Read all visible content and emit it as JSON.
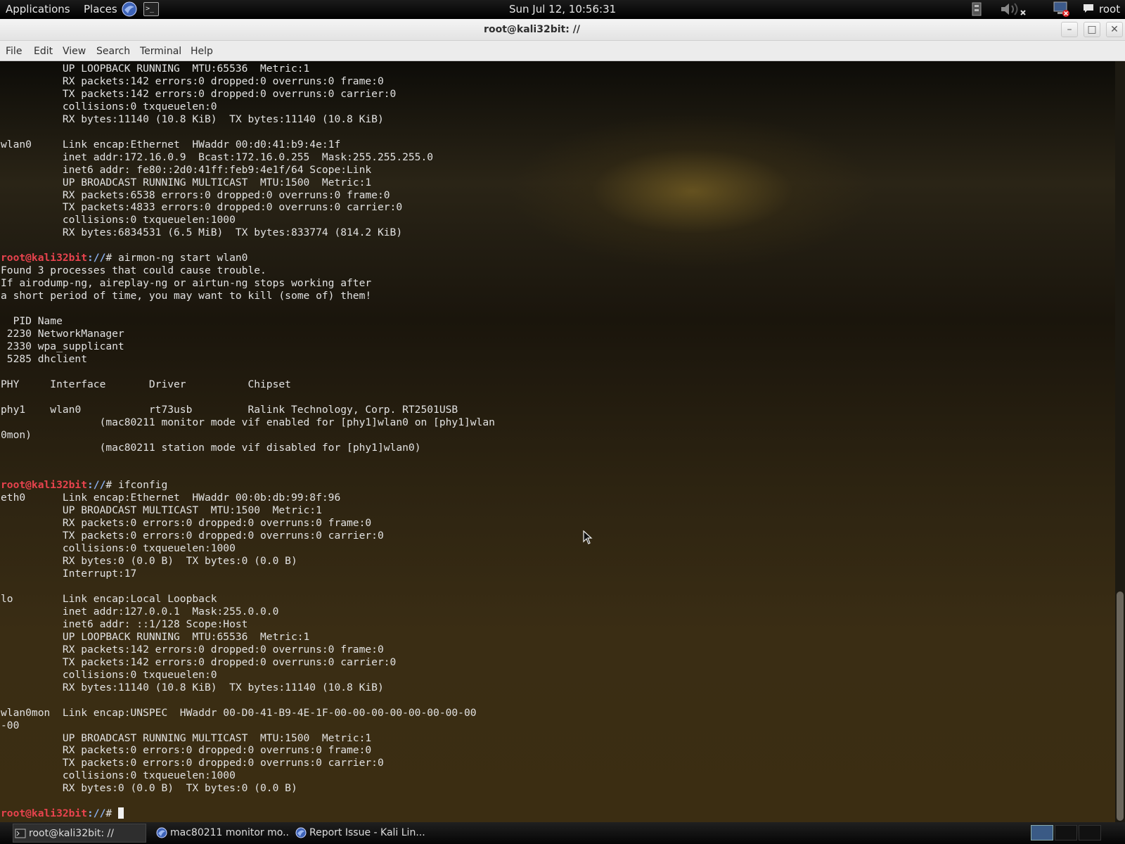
{
  "top_panel": {
    "applications": "Applications",
    "places": "Places",
    "clock": "Sun Jul 12, 10:56:31",
    "user": "root"
  },
  "window": {
    "title": "root@kali32bit: //",
    "menu": [
      "File",
      "Edit",
      "View",
      "Search",
      "Terminal",
      "Help"
    ]
  },
  "terminal": {
    "prompt_user": "root@kali32bit",
    "prompt_path": "://",
    "lines_before_1": [
      "          UP LOOPBACK RUNNING  MTU:65536  Metric:1",
      "          RX packets:142 errors:0 dropped:0 overruns:0 frame:0",
      "          TX packets:142 errors:0 dropped:0 overruns:0 carrier:0",
      "          collisions:0 txqueuelen:0",
      "          RX bytes:11140 (10.8 KiB)  TX bytes:11140 (10.8 KiB)",
      "",
      "wlan0     Link encap:Ethernet  HWaddr 00:d0:41:b9:4e:1f",
      "          inet addr:172.16.0.9  Bcast:172.16.0.255  Mask:255.255.255.0",
      "          inet6 addr: fe80::2d0:41ff:feb9:4e1f/64 Scope:Link",
      "          UP BROADCAST RUNNING MULTICAST  MTU:1500  Metric:1",
      "          RX packets:6538 errors:0 dropped:0 overruns:0 frame:0",
      "          TX packets:4833 errors:0 dropped:0 overruns:0 carrier:0",
      "          collisions:0 txqueuelen:1000",
      "          RX bytes:6834531 (6.5 MiB)  TX bytes:833774 (814.2 KiB)",
      ""
    ],
    "command_1": "# airmon-ng start wlan0",
    "lines_after_1": [
      "Found 3 processes that could cause trouble.",
      "If airodump-ng, aireplay-ng or airtun-ng stops working after",
      "a short period of time, you may want to kill (some of) them!",
      "",
      "  PID Name",
      " 2230 NetworkManager",
      " 2330 wpa_supplicant",
      " 5285 dhclient",
      "",
      "PHY\tInterface\tDriver\t\tChipset",
      "",
      "phy1\twlan0\t\trt73usb\t\tRalink Technology, Corp. RT2501USB",
      "\t\t(mac80211 monitor mode vif enabled for [phy1]wlan0 on [phy1]wlan",
      "0mon)",
      "\t\t(mac80211 station mode vif disabled for [phy1]wlan0)",
      "",
      ""
    ],
    "command_2": "# ifconfig",
    "lines_after_2": [
      "eth0      Link encap:Ethernet  HWaddr 00:0b:db:99:8f:96",
      "          UP BROADCAST MULTICAST  MTU:1500  Metric:1",
      "          RX packets:0 errors:0 dropped:0 overruns:0 frame:0",
      "          TX packets:0 errors:0 dropped:0 overruns:0 carrier:0",
      "          collisions:0 txqueuelen:1000",
      "          RX bytes:0 (0.0 B)  TX bytes:0 (0.0 B)",
      "          Interrupt:17",
      "",
      "lo        Link encap:Local Loopback",
      "          inet addr:127.0.0.1  Mask:255.0.0.0",
      "          inet6 addr: ::1/128 Scope:Host",
      "          UP LOOPBACK RUNNING  MTU:65536  Metric:1",
      "          RX packets:142 errors:0 dropped:0 overruns:0 frame:0",
      "          TX packets:142 errors:0 dropped:0 overruns:0 carrier:0",
      "          collisions:0 txqueuelen:0",
      "          RX bytes:11140 (10.8 KiB)  TX bytes:11140 (10.8 KiB)",
      "",
      "wlan0mon  Link encap:UNSPEC  HWaddr 00-D0-41-B9-4E-1F-00-00-00-00-00-00-00-00",
      "-00",
      "          UP BROADCAST RUNNING MULTICAST  MTU:1500  Metric:1",
      "          RX packets:0 errors:0 dropped:0 overruns:0 frame:0",
      "          TX packets:0 errors:0 dropped:0 overruns:0 carrier:0",
      "          collisions:0 txqueuelen:1000",
      "          RX bytes:0 (0.0 B)  TX bytes:0 (0.0 B)",
      ""
    ],
    "final_prompt_suffix": "# "
  },
  "taskbar": {
    "tasks": [
      "root@kali32bit: //",
      "mac80211 monitor mo...",
      "Report Issue - Kali Lin..."
    ]
  },
  "icons": {
    "browser": "browser-icon",
    "terminal": "terminal-icon",
    "volume": "volume-muted-icon",
    "network": "network-disconnected-icon",
    "chat": "chat-icon"
  },
  "colors": {
    "prompt_user": "#e8434e",
    "prompt_path": "#8ab0f0",
    "terminal_text": "#e2e2e2"
  }
}
